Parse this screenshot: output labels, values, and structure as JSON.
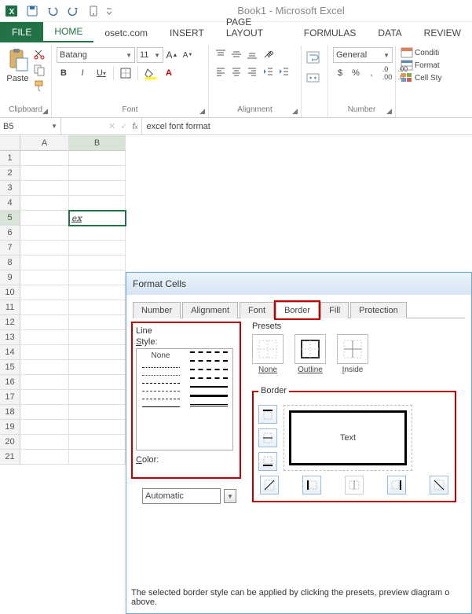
{
  "window": {
    "title": "Book1 - Microsoft Excel"
  },
  "ribbon": {
    "file": "FILE",
    "tabs": [
      "HOME",
      "osetc.com",
      "INSERT",
      "PAGE LAYOUT",
      "FORMULAS",
      "DATA",
      "REVIEW"
    ],
    "active_tab": "HOME",
    "clipboard": {
      "paste": "Paste",
      "label": "Clipboard"
    },
    "font": {
      "name": "Batang",
      "size": "11",
      "label": "Font",
      "bold": "B",
      "italic": "I",
      "underline": "U"
    },
    "alignment": {
      "label": "Alignment"
    },
    "number": {
      "format": "General",
      "label": "Number",
      "currency": "$",
      "percent": "%",
      "comma": ","
    },
    "styles": {
      "condfmt": "Conditi",
      "format_table": "Format",
      "cell_styles": "Cell Sty"
    }
  },
  "formula_bar": {
    "namebox": "B5",
    "value": "excel font format"
  },
  "grid": {
    "cols": [
      "A",
      "B"
    ],
    "rows": [
      "1",
      "2",
      "3",
      "4",
      "5",
      "6",
      "7",
      "8",
      "9",
      "10",
      "11",
      "12",
      "13",
      "14",
      "15",
      "16",
      "17",
      "18",
      "19",
      "20",
      "21"
    ],
    "b5_value": "ex"
  },
  "dialog": {
    "title": "Format Cells",
    "tabs": [
      "Number",
      "Alignment",
      "Font",
      "Border",
      "Fill",
      "Protection"
    ],
    "active_tab": "Border",
    "line_label": "Line",
    "style_label": "Style:",
    "style_none": "None",
    "color_label": "Color:",
    "color_value": "Automatic",
    "presets_label": "Presets",
    "preset_none": "None",
    "preset_outline": "Outline",
    "preset_inside": "Inside",
    "border_label": "Border",
    "preview_text": "Text",
    "help": "The selected border style can be applied by clicking the presets, preview diagram o above."
  }
}
